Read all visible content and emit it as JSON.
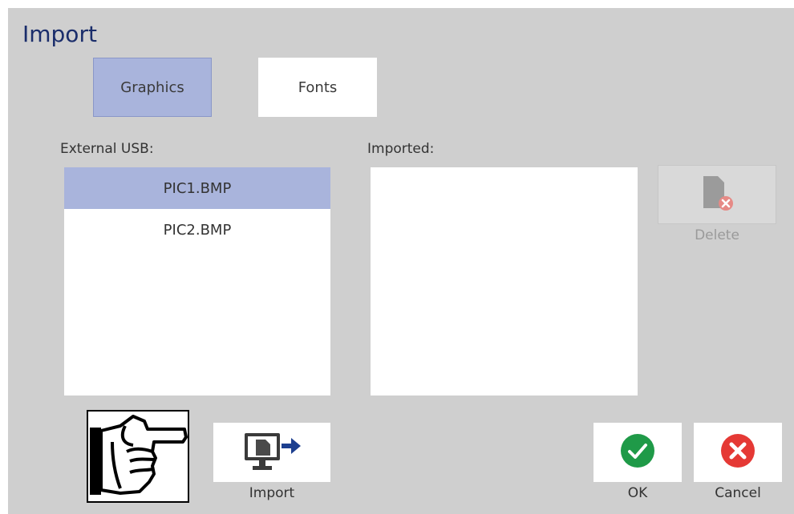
{
  "dialog": {
    "title": "Import"
  },
  "tabs": [
    {
      "label": "Graphics",
      "selected": true
    },
    {
      "label": "Fonts",
      "selected": false
    }
  ],
  "external": {
    "label": "External USB:",
    "items": [
      {
        "name": "PIC1.BMP",
        "selected": true
      },
      {
        "name": "PIC2.BMP",
        "selected": false
      }
    ]
  },
  "imported": {
    "label": "Imported:",
    "items": []
  },
  "buttons": {
    "delete_label": "Delete",
    "import_label": "Import",
    "ok_label": "OK",
    "cancel_label": "Cancel"
  },
  "colors": {
    "title": "#1a2d6b",
    "selection": "#a9b4dc",
    "ok_green": "#1f9a48",
    "cancel_red": "#e53935",
    "arrow_blue": "#1d3f8f"
  },
  "icons": [
    "pointing-hand-icon",
    "import-icon",
    "delete-file-icon",
    "ok-check-icon",
    "cancel-x-icon"
  ]
}
